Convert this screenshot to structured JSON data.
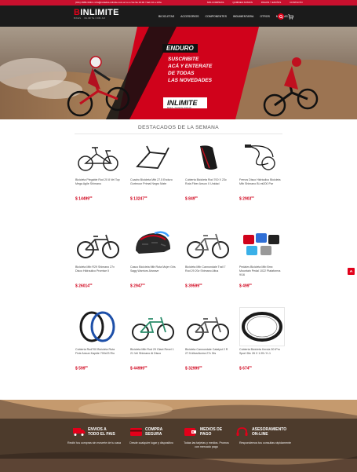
{
  "topbar": {
    "contact": "(011) 4983-3434  •  info@rodados-inlimite.com.ar  Lu a Vie 9a 19:30 / Sab 10 a 13hs",
    "links": [
      "MIS COMPRAS",
      "QUIÉNES SOMOS",
      "PAGOS Y ENVÍOS",
      "CONTACTO"
    ]
  },
  "header": {
    "brand_mark": "B",
    "brand": "INLIMITE",
    "tagline": "BIKES · INLIMITE.COM.AR",
    "nav": [
      "BICICLETAS",
      "ACCESORIOS",
      "COMPONENTES",
      "INDUMENTARIA",
      "OTROS",
      "MARCAS"
    ]
  },
  "hero": {
    "badge": "ENDURO",
    "promo_lines": [
      "SUSCRIBITE",
      "ACÁ Y ENTERATE",
      "DE TODAS",
      "LAS NOVEDADES"
    ],
    "logo_brand": "INLIMITE",
    "logo_tag": "BIKES · INLIMITE.COM.AR"
  },
  "section": {
    "title": "DESTACADOS DE LA SEMANA"
  },
  "products": [
    {
      "name": "Bicicleta Plegable Rod 20 8 Vel Top Mega Agile Shimano",
      "price": "$ 14499",
      "cents": "00"
    },
    {
      "name": "Cuadro Bicicleta Mtb 27.5 Enduro Gortmoor Primal Negro Mate",
      "price": "$ 13247",
      "cents": "00"
    },
    {
      "name": "Cubierta Bicicleta Rod 700 X 23c Ruta Fiber Ansun X Unidad",
      "price": "$ 849",
      "cents": "00"
    },
    {
      "name": "Frenos Disco Hidráulico Bicicleta Mtb Shimano Bl-mt200 Par",
      "price": "$ 2903",
      "cents": "00"
    },
    {
      "name": "Bicicleta Mtb R29 Shimano 27v Disco Hidraulico Promise II",
      "price": "$ 26014",
      "cents": "00"
    },
    {
      "name": "Casco Bicicleta Mtb Ruta Mujer Gris Sagg Warriors Airwave",
      "price": "$ 2947",
      "cents": "00"
    },
    {
      "name": "Bicicleta Mtb Cannondale Trail 7 Rod 29 20v Shimano Altus",
      "price": "$ 39599",
      "cents": "00"
    },
    {
      "name": "Pedales Bicicleta Mtb Bmx Mountain Pedal 1022 Plataforma 9/16",
      "price": "$ 499",
      "cents": "00"
    },
    {
      "name": "Cubierta Rod700 Bicicleta Ruta Fixie Ansun Kapide 700x23 Rio",
      "price": "$ 599",
      "cents": "00"
    },
    {
      "name": "Bicicleta Mtb Rod 29 Giant Revel 1 21 Vel Shimano Al Disco",
      "price": "$ 44999",
      "cents": "00"
    },
    {
      "name": "Bicicleta Cannondale Catalyst 2 R 27.5 Altus/Acera 27v Dis",
      "price": "$ 32999",
      "cents": "00"
    },
    {
      "name": "Cubierta Bicicleta Kenda 30 tPro Sport Dtc 26 X 1.95 / K-1",
      "price": "$ 674",
      "cents": "00"
    }
  ],
  "features": [
    {
      "icon": "truck-icon",
      "title_lines": [
        "ENVIOS A",
        "TODO EL PAIS"
      ],
      "desc": "Recibí tus compras sin moverte de tu casa"
    },
    {
      "icon": "card-icon",
      "title_lines": [
        "COMPRA",
        "SEGURA"
      ],
      "desc": "Desde cualquier lugar y dispositivo"
    },
    {
      "icon": "wallet-icon",
      "title_lines": [
        "MEDIOS DE",
        "PAGO"
      ],
      "desc": "Todas las tarjetas y medios. Promos con mercado pago"
    },
    {
      "icon": "headset-icon",
      "title_lines": [
        "ASESORAMIENTO",
        "ON-LINE"
      ],
      "desc": "Respondemos tus consultas rápidamente"
    }
  ],
  "colors": {
    "brand_red": "#e2001a",
    "price_red": "#d0021b",
    "dark": "#1b1b1b"
  }
}
